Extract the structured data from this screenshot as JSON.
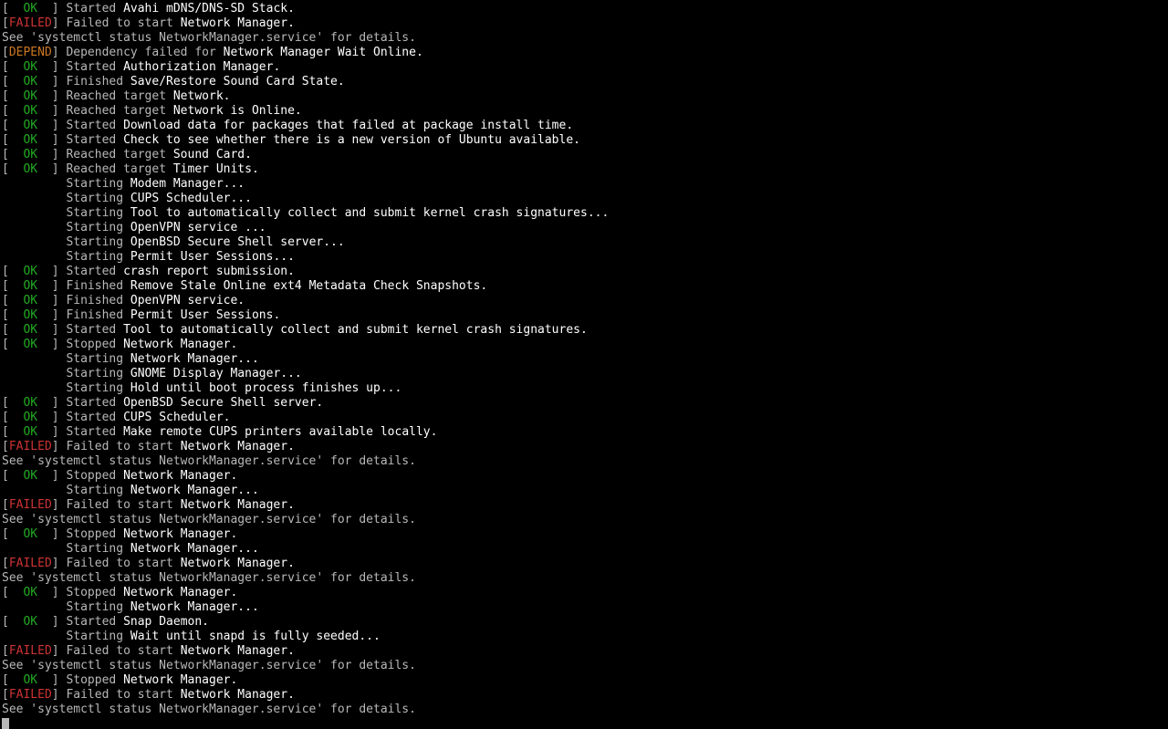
{
  "statuses": {
    "ok": "OK",
    "failed": "FAILED",
    "depend": "DEPEND"
  },
  "lines": [
    {
      "type": "status",
      "status": "ok",
      "action": "Started",
      "service": "Avahi mDNS/DNS-SD Stack."
    },
    {
      "type": "status",
      "status": "failed",
      "action": "Failed to start",
      "service": "Network Manager."
    },
    {
      "type": "msg",
      "text": "See 'systemctl status NetworkManager.service' for details."
    },
    {
      "type": "status",
      "status": "depend",
      "action": "Dependency failed for",
      "service": "Network Manager Wait Online."
    },
    {
      "type": "status",
      "status": "ok",
      "action": "Started",
      "service": "Authorization Manager."
    },
    {
      "type": "status",
      "status": "ok",
      "action": "Finished",
      "service": "Save/Restore Sound Card State."
    },
    {
      "type": "status",
      "status": "ok",
      "action": "Reached target",
      "service": "Network."
    },
    {
      "type": "status",
      "status": "ok",
      "action": "Reached target",
      "service": "Network is Online."
    },
    {
      "type": "status",
      "status": "ok",
      "action": "Started",
      "service": "Download data for packages that failed at package install time."
    },
    {
      "type": "status",
      "status": "ok",
      "action": "Started",
      "service": "Check to see whether there is a new version of Ubuntu available."
    },
    {
      "type": "status",
      "status": "ok",
      "action": "Reached target",
      "service": "Sound Card."
    },
    {
      "type": "status",
      "status": "ok",
      "action": "Reached target",
      "service": "Timer Units."
    },
    {
      "type": "indent",
      "action": "Starting",
      "service": "Modem Manager..."
    },
    {
      "type": "indent",
      "action": "Starting",
      "service": "CUPS Scheduler..."
    },
    {
      "type": "indent",
      "action": "Starting",
      "service": "Tool to automatically collect and submit kernel crash signatures..."
    },
    {
      "type": "indent",
      "action": "Starting",
      "service": "OpenVPN service ..."
    },
    {
      "type": "indent",
      "action": "Starting",
      "service": "OpenBSD Secure Shell server..."
    },
    {
      "type": "indent",
      "action": "Starting",
      "service": "Permit User Sessions..."
    },
    {
      "type": "status",
      "status": "ok",
      "action": "Started",
      "service": "crash report submission."
    },
    {
      "type": "status",
      "status": "ok",
      "action": "Finished",
      "service": "Remove Stale Online ext4 Metadata Check Snapshots."
    },
    {
      "type": "status",
      "status": "ok",
      "action": "Finished",
      "service": "OpenVPN service."
    },
    {
      "type": "status",
      "status": "ok",
      "action": "Finished",
      "service": "Permit User Sessions."
    },
    {
      "type": "status",
      "status": "ok",
      "action": "Started",
      "service": "Tool to automatically collect and submit kernel crash signatures."
    },
    {
      "type": "status",
      "status": "ok",
      "action": "Stopped",
      "service": "Network Manager."
    },
    {
      "type": "indent",
      "action": "Starting",
      "service": "Network Manager..."
    },
    {
      "type": "indent",
      "action": "Starting",
      "service": "GNOME Display Manager..."
    },
    {
      "type": "indent",
      "action": "Starting",
      "service": "Hold until boot process finishes up..."
    },
    {
      "type": "status",
      "status": "ok",
      "action": "Started",
      "service": "OpenBSD Secure Shell server."
    },
    {
      "type": "status",
      "status": "ok",
      "action": "Started",
      "service": "CUPS Scheduler."
    },
    {
      "type": "status",
      "status": "ok",
      "action": "Started",
      "service": "Make remote CUPS printers available locally."
    },
    {
      "type": "status",
      "status": "failed",
      "action": "Failed to start",
      "service": "Network Manager."
    },
    {
      "type": "msg",
      "text": "See 'systemctl status NetworkManager.service' for details."
    },
    {
      "type": "status",
      "status": "ok",
      "action": "Stopped",
      "service": "Network Manager."
    },
    {
      "type": "indent",
      "action": "Starting",
      "service": "Network Manager..."
    },
    {
      "type": "status",
      "status": "failed",
      "action": "Failed to start",
      "service": "Network Manager."
    },
    {
      "type": "msg",
      "text": "See 'systemctl status NetworkManager.service' for details."
    },
    {
      "type": "status",
      "status": "ok",
      "action": "Stopped",
      "service": "Network Manager."
    },
    {
      "type": "indent",
      "action": "Starting",
      "service": "Network Manager..."
    },
    {
      "type": "status",
      "status": "failed",
      "action": "Failed to start",
      "service": "Network Manager."
    },
    {
      "type": "msg",
      "text": "See 'systemctl status NetworkManager.service' for details."
    },
    {
      "type": "status",
      "status": "ok",
      "action": "Stopped",
      "service": "Network Manager."
    },
    {
      "type": "indent",
      "action": "Starting",
      "service": "Network Manager..."
    },
    {
      "type": "status",
      "status": "ok",
      "action": "Started",
      "service": "Snap Daemon."
    },
    {
      "type": "indent",
      "action": "Starting",
      "service": "Wait until snapd is fully seeded..."
    },
    {
      "type": "status",
      "status": "failed",
      "action": "Failed to start",
      "service": "Network Manager."
    },
    {
      "type": "msg",
      "text": "See 'systemctl status NetworkManager.service' for details."
    },
    {
      "type": "status",
      "status": "ok",
      "action": "Stopped",
      "service": "Network Manager."
    },
    {
      "type": "status",
      "status": "failed",
      "action": "Failed to start",
      "service": "Network Manager."
    },
    {
      "type": "msg",
      "text": "See 'systemctl status NetworkManager.service' for details."
    }
  ]
}
